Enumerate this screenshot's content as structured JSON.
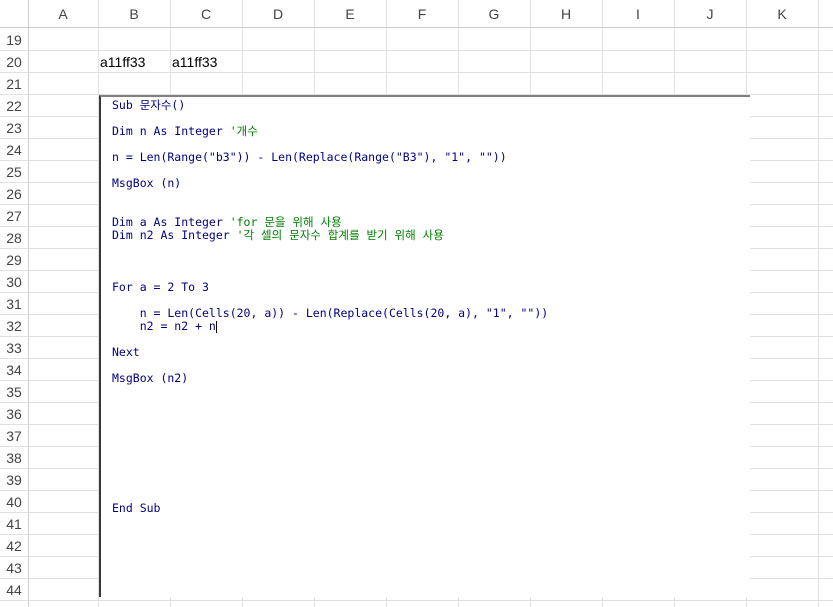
{
  "columns": [
    "A",
    "B",
    "C",
    "D",
    "E",
    "F",
    "G",
    "H",
    "I",
    "J",
    "K"
  ],
  "rows": [
    "19",
    "20",
    "21",
    "22",
    "23",
    "24",
    "25",
    "26",
    "27",
    "28",
    "29",
    "30",
    "31",
    "32",
    "33",
    "34",
    "35",
    "36",
    "37",
    "38",
    "39",
    "40",
    "41",
    "42",
    "43",
    "44"
  ],
  "cells": {
    "B20": "a11ff33",
    "C20": "a11ff33"
  },
  "code": [
    {
      "text": "Sub 문자수()"
    },
    {
      "text": "Dim n As Integer ",
      "comment": "'개수"
    },
    {
      "text": "n = Len(Range(\"b3\")) - Len(Replace(Range(\"B3\"), \"1\", \"\"))"
    },
    {
      "text": "MsgBox (n)"
    },
    {
      "text": "Dim a As Integer ",
      "comment": "'for 문을 위해 사용"
    },
    {
      "text": "Dim n2 As Integer ",
      "comment": "'각 셀의 문자수 합계를 받기 위해 사용"
    },
    {
      "text": "For a = 2 To 3"
    },
    {
      "text": "    n = Len(Cells(20, a)) - Len(Replace(Cells(20, a), \"1\", \"\"))"
    },
    {
      "text": "    n2 = n2 + n"
    },
    {
      "text": "Next"
    },
    {
      "text": "MsgBox (n2)"
    },
    {
      "text": "End Sub"
    }
  ]
}
